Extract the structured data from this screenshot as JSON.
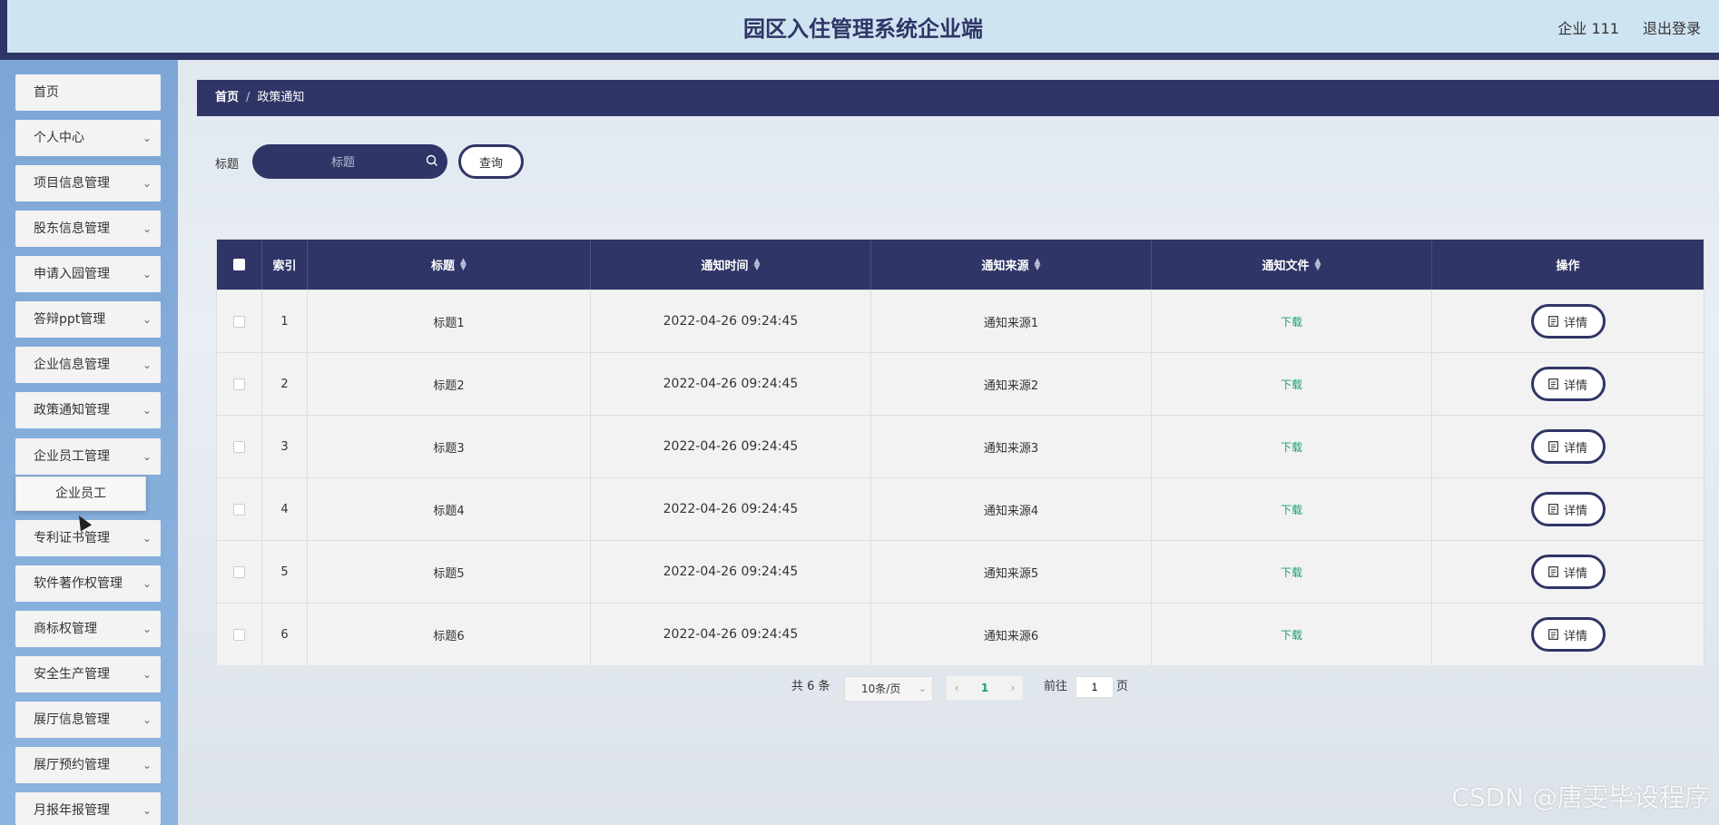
{
  "header": {
    "title": "园区入住管理系统企业端",
    "user": "企业 111",
    "logout": "退出登录"
  },
  "sidebar": {
    "items": [
      {
        "label": "首页",
        "has_chevron": false
      },
      {
        "label": "个人中心",
        "has_chevron": true
      },
      {
        "label": "项目信息管理",
        "has_chevron": true
      },
      {
        "label": "股东信息管理",
        "has_chevron": true
      },
      {
        "label": "申请入园管理",
        "has_chevron": true
      },
      {
        "label": "答辩ppt管理",
        "has_chevron": true
      },
      {
        "label": "企业信息管理",
        "has_chevron": true
      },
      {
        "label": "政策通知管理",
        "has_chevron": true
      },
      {
        "label": "企业员工管理",
        "has_chevron": true
      },
      {
        "label": "专利证书管理",
        "has_chevron": true
      },
      {
        "label": "软件著作权管理",
        "has_chevron": true
      },
      {
        "label": "商标权管理",
        "has_chevron": true
      },
      {
        "label": "安全生产管理",
        "has_chevron": true
      },
      {
        "label": "展厅信息管理",
        "has_chevron": true
      },
      {
        "label": "展厅预约管理",
        "has_chevron": true
      },
      {
        "label": "月报年报管理",
        "has_chevron": true
      }
    ],
    "submenu_open": "企业员工"
  },
  "breadcrumb": {
    "home": "首页",
    "separator": "/",
    "current": "政策通知"
  },
  "search": {
    "label": "标题",
    "placeholder": "标题",
    "button": "查询"
  },
  "table": {
    "columns": [
      "索引",
      "标题",
      "通知时间",
      "通知来源",
      "通知文件",
      "操作"
    ],
    "rows": [
      {
        "index": "1",
        "title": "标题1",
        "time": "2022-04-26 09:24:45",
        "source": "通知来源1",
        "file": "下载",
        "action": "详情"
      },
      {
        "index": "2",
        "title": "标题2",
        "time": "2022-04-26 09:24:45",
        "source": "通知来源2",
        "file": "下载",
        "action": "详情"
      },
      {
        "index": "3",
        "title": "标题3",
        "time": "2022-04-26 09:24:45",
        "source": "通知来源3",
        "file": "下载",
        "action": "详情"
      },
      {
        "index": "4",
        "title": "标题4",
        "time": "2022-04-26 09:24:45",
        "source": "通知来源4",
        "file": "下载",
        "action": "详情"
      },
      {
        "index": "5",
        "title": "标题5",
        "time": "2022-04-26 09:24:45",
        "source": "通知来源5",
        "file": "下载",
        "action": "详情"
      },
      {
        "index": "6",
        "title": "标题6",
        "time": "2022-04-26 09:24:45",
        "source": "通知来源6",
        "file": "下载",
        "action": "详情"
      }
    ]
  },
  "pagination": {
    "total": "共 6 条",
    "page_size": "10条/页",
    "current_page": "1",
    "goto_prefix": "前往",
    "goto_value": "1",
    "goto_suffix": "页"
  },
  "watermark": "CSDN @唐雯毕设程序",
  "colors": {
    "primary": "#2f3566",
    "header_bg": "#cfe4f1",
    "sidebar_bg": "#8db4df",
    "download": "#1a9e6f"
  }
}
